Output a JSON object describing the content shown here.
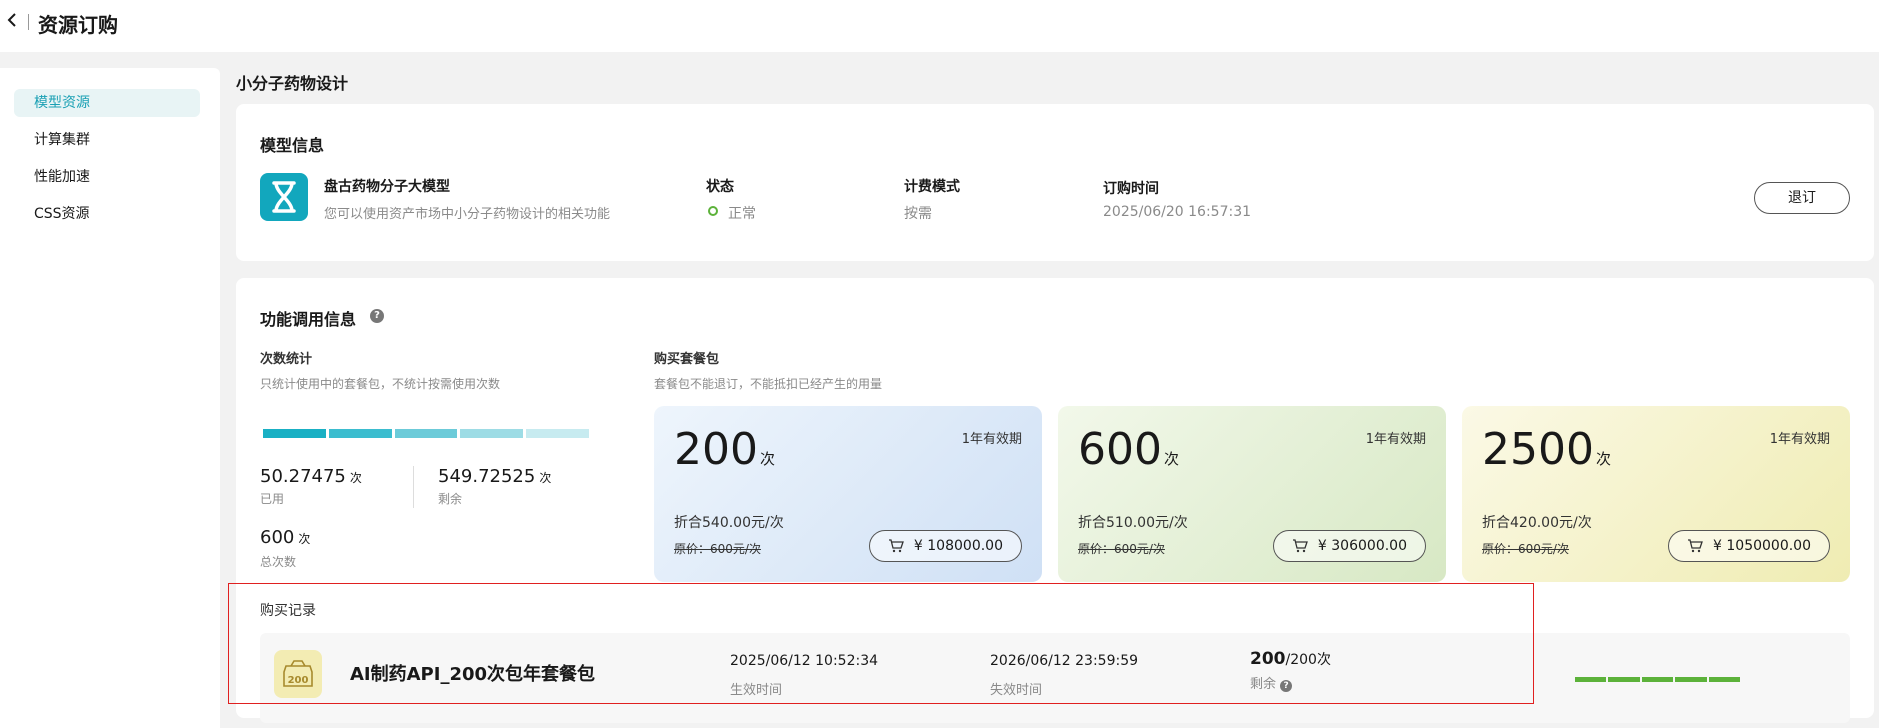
{
  "header": {
    "back_icon": "chevron-left-icon",
    "title": "资源订购"
  },
  "sidebar": {
    "items": [
      {
        "label": "模型资源",
        "active": true
      },
      {
        "label": "计算集群",
        "active": false
      },
      {
        "label": "性能加速",
        "active": false
      },
      {
        "label": "CSS资源",
        "active": false
      }
    ]
  },
  "section_title": "小分子药物设计",
  "model_info": {
    "title": "模型信息",
    "icon": "hourglass-icon",
    "name": "盘古药物分子大模型",
    "desc": "您可以使用资产市场中小分子药物设计的相关功能",
    "status_label": "状态",
    "status_value": "正常",
    "status_color": "#5cb23a",
    "billing_label": "计费模式",
    "billing_value": "按需",
    "order_time_label": "订购时间",
    "order_time_value": "2025/06/20 16:57:31",
    "unsubscribe_label": "退订"
  },
  "usage": {
    "title": "功能调用信息",
    "help_icon": "?",
    "stats": {
      "title": "次数统计",
      "desc": "只统计使用中的套餐包，不统计按需使用次数",
      "used_value": "50.27475",
      "used_unit": "次",
      "used_label": "已用",
      "remain_value": "549.72525",
      "remain_unit": "次",
      "remain_label": "剩余",
      "total_value": "600",
      "total_unit": "次",
      "total_label": "总次数"
    },
    "packages": {
      "title": "购买套餐包",
      "desc": "套餐包不能退订，不能抵扣已经产生的用量",
      "items": [
        {
          "count": "200",
          "unit": "次",
          "validity": "1年有效期",
          "unit_price": "折合540.00元/次",
          "orig_price": "原价：600元/次",
          "price": "¥ 108000.00"
        },
        {
          "count": "600",
          "unit": "次",
          "validity": "1年有效期",
          "unit_price": "折合510.00元/次",
          "orig_price": "原价：600元/次",
          "price": "¥ 306000.00"
        },
        {
          "count": "2500",
          "unit": "次",
          "validity": "1年有效期",
          "unit_price": "折合420.00元/次",
          "orig_price": "原价：600元/次",
          "price": "¥ 1050000.00"
        }
      ]
    }
  },
  "records": {
    "title": "购买记录",
    "items": [
      {
        "badge": "200",
        "name": "AI制药API_200次包年套餐包",
        "start_value": "2025/06/12 10:52:34",
        "start_label": "生效时间",
        "end_value": "2026/06/12 23:59:59",
        "end_label": "失效时间",
        "remain_count": "200",
        "remain_total": "/200次",
        "remain_label": "剩余",
        "remain_fraction": 1.0,
        "help_icon": "?"
      }
    ]
  }
}
